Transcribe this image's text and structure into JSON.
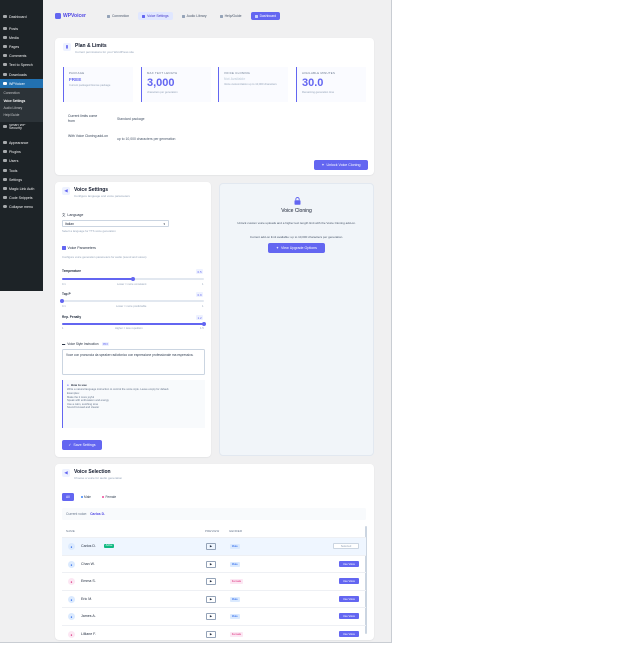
{
  "sidebar": {
    "items": [
      {
        "label": "Dashboard"
      },
      {
        "label": "Posts"
      },
      {
        "label": "Media"
      },
      {
        "label": "Pages"
      },
      {
        "label": "Comments"
      },
      {
        "label": "Text to Speech"
      },
      {
        "label": "Downloads"
      },
      {
        "label": "WPVoicer"
      }
    ],
    "submenu": [
      "Connection",
      "Voice Settings",
      "Audio Library",
      "Help/Guide"
    ],
    "items_lower": [
      {
        "label": "Smart WP Security"
      },
      {
        "label": "Appearance"
      },
      {
        "label": "Plugins"
      },
      {
        "label": "Users"
      },
      {
        "label": "Tools"
      },
      {
        "label": "Settings"
      },
      {
        "label": "Magic Link Auth"
      },
      {
        "label": "Code Snippets"
      },
      {
        "label": "Collapse menu"
      }
    ]
  },
  "nav": {
    "brand": "WPVoicer",
    "tabs": [
      "Connection",
      "Voice Settings",
      "Audio Library",
      "Help/Guide"
    ],
    "cta": "Dashboard"
  },
  "plan": {
    "title": "Plan & Limits",
    "subtitle": "Current permissions for your WordPress site",
    "stats": [
      {
        "label": "PACKAGE",
        "value": "FREE",
        "desc": "Current packaged license package"
      },
      {
        "label": "MAX TEXT LENGTH",
        "value": "3,000",
        "desc": "characters per generation"
      },
      {
        "label": "VOICE CLONING",
        "value": "Not Available",
        "desc": "Voice customization up to 10,000 characters"
      },
      {
        "label": "AVAILABLE MINUTES",
        "value": "30.0",
        "desc": "Remaining generation time"
      }
    ],
    "limits": [
      {
        "label": "Current limits come from",
        "value": "Standard package"
      },
      {
        "label": "With Voice Cloning add-on",
        "value": "up to 10,000 characters per generation"
      }
    ],
    "unlock_button": "Unlock Voice Cloning"
  },
  "voice_settings": {
    "title": "Voice Settings",
    "subtitle": "Configure language and voice parameters",
    "language_label": "Language",
    "language_value": "Italian",
    "language_hint": "Select a language for TTS voice generation",
    "params_label": "Voice Parameters",
    "params_hint": "Configure voice generation parameters for audio (sound and voices)",
    "temperature": {
      "label": "Temperature",
      "value": "0.5",
      "min": "0.1",
      "max": "1",
      "hint": "Lower = more consistent",
      "fraction": 0.5
    },
    "top_p": {
      "label": "Top P",
      "value": "0.9",
      "min": "0.1",
      "max": "1",
      "hint": "Lower = more predictable",
      "fraction": 0.0
    },
    "rep_penalty": {
      "label": "Rep. Penalty",
      "value": "1.2",
      "min": "1",
      "max": "1.5",
      "hint": "Higher = less repetition",
      "fraction": 1.0
    },
    "style_label": "Voice Style Instruction",
    "style_badge": "PRO",
    "style_value": "Voce con pronuncia da speaker radiofonico con espressione professionale ma espressiva.",
    "howto_title": "How to use",
    "howto_lines": [
      "Write a natural language instruction to control the voice style. Leave empty for default.",
      "Examples:",
      "Make the it more joyful",
      "Speak with enthusiasm and energy",
      "Use a calm, soothing tone",
      "Sound focused and clearer"
    ],
    "save_button": "Save Settings"
  },
  "cloning": {
    "title": "Voice Cloning",
    "desc": "Unlock custom voice uploads and a higher text length limit with the Voice Cloning add-on.",
    "note": "Current add-on limit available: up to 10,000 characters per generation.",
    "button": "View Upgrade Options"
  },
  "voice_selection": {
    "title": "Voice Selection",
    "subtitle": "Choose a voice for audio generation",
    "filters": [
      "All",
      "Male",
      "Female"
    ],
    "current_label": "Current voice:",
    "current_value": "Carlos D.",
    "columns": [
      "NAME",
      "PREVIEW",
      "GENDER",
      ""
    ],
    "rows": [
      {
        "name": "Carlos D.",
        "badge": "Active",
        "gender": "Male",
        "action": "Selected",
        "selected": true
      },
      {
        "name": "Chan W.",
        "badge": "",
        "gender": "Male",
        "action": "Use Voice",
        "selected": false
      },
      {
        "name": "Emma S.",
        "badge": "",
        "gender": "Female",
        "action": "Use Voice",
        "selected": false
      },
      {
        "name": "Eric M.",
        "badge": "",
        "gender": "Male",
        "action": "Use Voice",
        "selected": false
      },
      {
        "name": "James A.",
        "badge": "",
        "gender": "Male",
        "action": "Use Voice",
        "selected": false
      },
      {
        "name": "Lilliane F.",
        "badge": "",
        "gender": "Female",
        "action": "Use Voice",
        "selected": false
      }
    ]
  },
  "colors": {
    "accent": "#6366f1",
    "wp_sidebar": "#1d2327",
    "wp_active": "#2271b1"
  }
}
